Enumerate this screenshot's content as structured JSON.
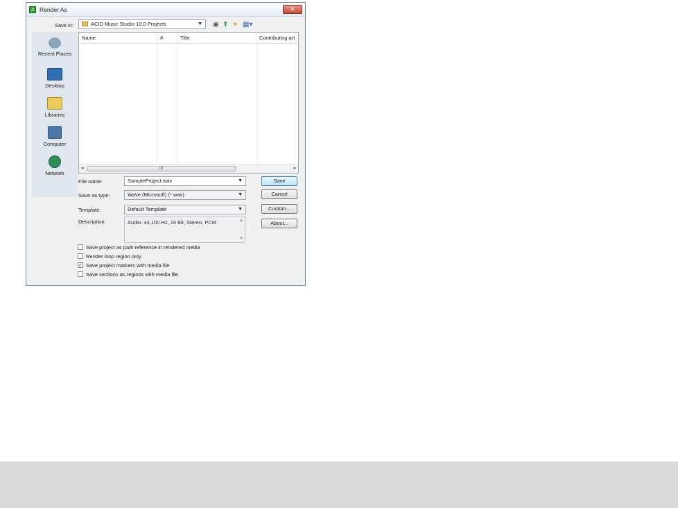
{
  "dialog": {
    "title": "Render As",
    "close_glyph": "✕"
  },
  "save_in": {
    "label": "Save in:",
    "value": "ACID Music Studio 10.0 Projects"
  },
  "toolbar_icons": [
    "back-icon",
    "up-folder-icon",
    "new-folder-icon",
    "view-menu-icon"
  ],
  "places": [
    {
      "label": "Recent Places",
      "icon": "recent-places-icon",
      "color": "#6f86a6"
    },
    {
      "label": "Desktop",
      "icon": "desktop-icon",
      "color": "#2f6fb6"
    },
    {
      "label": "Libraries",
      "icon": "libraries-icon",
      "color": "#e6c65a"
    },
    {
      "label": "Computer",
      "icon": "computer-icon",
      "color": "#4a79a8"
    },
    {
      "label": "Network",
      "icon": "network-icon",
      "color": "#2d8f55"
    }
  ],
  "file_list": {
    "columns": [
      "Name",
      "#",
      "Title",
      "Contributing art"
    ],
    "scroll_thumb_mark": "III",
    "scroll_left": "◂",
    "scroll_right": "▸"
  },
  "form": {
    "file_name_label": "File name:",
    "file_name_value": "SampleProject.wav",
    "save_type_label": "Save as type:",
    "save_type_value": "Wave (Microsoft) (*.wav)",
    "template_label": "Template:",
    "template_value": "Default Template",
    "description_label": "Description:",
    "description_value": "Audio: 44,100 Hz, 16 Bit, Stereo, PCM"
  },
  "buttons": {
    "save": "Save",
    "cancel": "Cancel",
    "custom": "Custom...",
    "about": "About..."
  },
  "checkboxes": [
    {
      "label": "Save project as path reference in rendered media",
      "checked": false
    },
    {
      "label": "Render loop region only",
      "checked": false
    },
    {
      "label": "Save project markers with media file",
      "checked": true
    },
    {
      "label": "Save sections as regions with media file",
      "checked": false
    }
  ],
  "check_glyph": "✓"
}
